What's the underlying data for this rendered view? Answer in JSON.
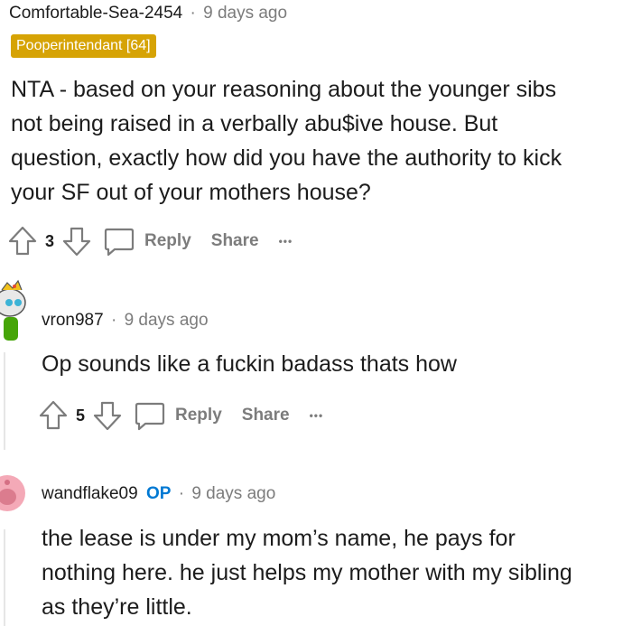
{
  "comments": [
    {
      "author": "Comfortable-Sea-2454",
      "separator": "·",
      "time": "9 days ago",
      "flair": "Pooperintendant [64]",
      "lines": [
        "NTA - based on your reasoning about the younger sibs",
        "not being raised in a verbally abu$ive house. But",
        "question, exactly how did you have the authority to kick",
        "your SF out of your mothers house?"
      ],
      "score": "3",
      "reply_label": "Reply",
      "share_label": "Share",
      "more_label": "•••"
    },
    {
      "author": "vron987",
      "separator": "·",
      "time": "9 days ago",
      "lines": [
        "Op sounds like a fuckin badass thats how"
      ],
      "score": "5",
      "reply_label": "Reply",
      "share_label": "Share",
      "more_label": "•••"
    },
    {
      "author": "wandflake09",
      "op_badge": "OP",
      "separator": "·",
      "time": "9 days ago",
      "lines": [
        "the lease is under my mom’s name, he pays for",
        "nothing here. he just helps my mother with my sibling",
        "as they’re little."
      ]
    }
  ],
  "colors": {
    "flair_bg": "#d6a305",
    "op_blue": "#0079d3",
    "muted": "#7c7c7c",
    "thread_line": "#e6e6e6"
  },
  "icons": [
    "upvote-icon",
    "downvote-icon",
    "comment-bubble-icon",
    "more-icon",
    "avatar-snoo-green",
    "avatar-snoo-pink"
  ]
}
